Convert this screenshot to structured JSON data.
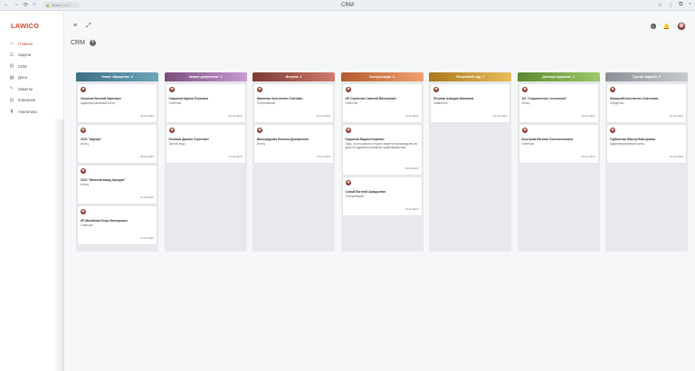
{
  "browser": {
    "title": "CRM",
    "url": "Search / c.l.c"
  },
  "logo": "LAWICO",
  "sidebar": {
    "items": [
      {
        "label": "Главная",
        "icon": "home-icon",
        "active": true
      },
      {
        "label": "Задачи",
        "icon": "tasks-icon",
        "active": false
      },
      {
        "label": "CRM",
        "icon": "crm-icon",
        "active": false
      },
      {
        "label": "Дела",
        "icon": "cases-icon",
        "active": false
      },
      {
        "label": "Заметки",
        "icon": "notes-icon",
        "active": false
      },
      {
        "label": "Компания",
        "icon": "company-icon",
        "active": false
      },
      {
        "label": "Аналитика",
        "icon": "analytics-icon",
        "active": false
      }
    ]
  },
  "page": {
    "title": "CRM",
    "add_label": "+"
  },
  "columns": [
    {
      "title": "Новое обращение",
      "count": "4",
      "color_from": "#3f6f86",
      "color_to": "#6aa6b8",
      "cards": [
        {
          "name": "Симонов Евгений Иванович",
          "role": "Административный истец",
          "date": "09.02.2023"
        },
        {
          "name": "ООО \"Аврора\"",
          "role": "Истец",
          "date": "09.02.2023"
        },
        {
          "name": "ООО \"Минский завод Арнодис\"",
          "role": "Истец",
          "date": "13.02.2023"
        },
        {
          "name": "ИП Михайлов Игорь Викторович",
          "role": "Ответчик",
          "date": "16.02.2023"
        }
      ]
    },
    {
      "title": "Запрос документов",
      "count": "2",
      "color_from": "#7a4f7d",
      "color_to": "#c89ad0",
      "cards": [
        {
          "name": "Гаврилов Карина Петровна",
          "role": "Ответчик",
          "date": "08.02.2023"
        },
        {
          "name": "Полевов Даниил Сергеевич",
          "role": "Третье лицо",
          "date": "14.02.2023"
        }
      ]
    },
    {
      "title": "Встреча",
      "count": "2",
      "color_from": "#7b3a34",
      "color_to": "#d07a6c",
      "cards": [
        {
          "name": "Иваненко Константин Олегович",
          "role": "Потерпевший",
          "date": "10.02.2023"
        },
        {
          "name": "Виноградская Наталья Дмитриевна",
          "role": "Истец",
          "date": "15.02.2023"
        }
      ]
    },
    {
      "title": "Консультация",
      "count": "3",
      "color_from": "#b55a2c",
      "color_to": "#f0a070",
      "cards": [
        {
          "name": "ИП Сергиенко Савелий Викторович",
          "role": "Ответчик",
          "date": "10.02.2023"
        },
        {
          "name": "Гаврилюк Вадим Игоревич",
          "role": "Лицо, в отношении которого ведется производство по делу об административном правонарушении",
          "date": "15.02.2023"
        },
        {
          "name": "Совый Евгений Аркадьевич",
          "role": "Потерпевший",
          "date": "16.02.2023"
        }
      ]
    },
    {
      "title": "На целевой лид",
      "count": "1",
      "color_from": "#a9791e",
      "color_to": "#e6bd5a",
      "cards": [
        {
          "name": "Петрова Аландия Ивановна",
          "role": "Заявитель",
          "date": "16.02.2023"
        }
      ]
    },
    {
      "title": "Договор подписан",
      "count": "2",
      "color_from": "#5c8a2e",
      "color_to": "#9cc86a",
      "cards": [
        {
          "name": "АО \"Современные технологии\"",
          "role": "Истец",
          "date": "10.02.2023"
        },
        {
          "name": "Быстрова Евгения Константиновна",
          "role": "Ответчик",
          "date": "15.02.2023"
        }
      ]
    },
    {
      "title": "Сделка закрыта",
      "count": "2",
      "color_from": "#8c9096",
      "color_to": "#c7cacf",
      "cards": [
        {
          "name": "Новицкий Константин Семенович",
          "role": "Свидетель",
          "date": "16.02.2023"
        },
        {
          "name": "Горбаченко Виктор Викторович",
          "role": "Административный истец",
          "date": "16.02.2023"
        }
      ]
    }
  ]
}
